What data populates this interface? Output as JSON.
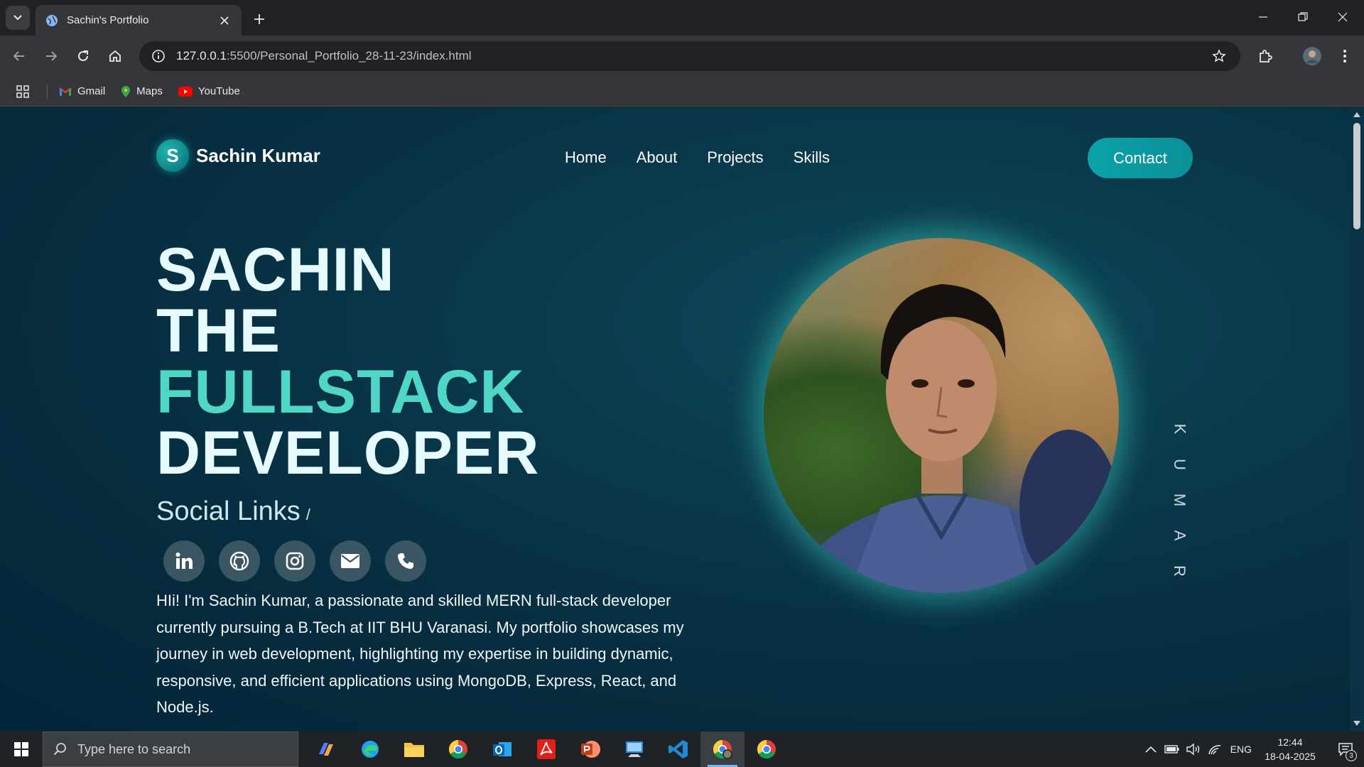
{
  "browser": {
    "tab_title": "Sachin's Portfolio",
    "url_host": "127.0.0.1",
    "url_rest": ":5500/Personal_Portfolio_28-11-23/index.html",
    "bookmarks": [
      {
        "label": "Gmail",
        "icon": "gmail-icon"
      },
      {
        "label": "Maps",
        "icon": "maps-icon"
      },
      {
        "label": "YouTube",
        "icon": "youtube-icon"
      }
    ]
  },
  "site": {
    "brand_letter": "S",
    "brand_name": "Sachin Kumar",
    "nav": [
      "Home",
      "About",
      "Projects",
      "Skills"
    ],
    "contact_label": "Contact",
    "hero": {
      "line1": "SACHIN",
      "line2": "THE",
      "line3": "FULLSTACK",
      "line4": "DEVELOPER"
    },
    "social_title": "Social Links",
    "social_slash": "/",
    "social_icons": [
      "linkedin-icon",
      "github-icon",
      "instagram-icon",
      "email-icon",
      "phone-icon"
    ],
    "bio": "HIi! I'm Sachin Kumar, a passionate and skilled MERN full-stack developer currently pursuing a B.Tech at IIT BHU Varanasi. My portfolio showcases my journey in web development, highlighting my expertise in building dynamic, responsive, and efficient applications using MongoDB, Express, React, and Node.js.",
    "side_letters": [
      "K",
      "U",
      "M",
      "A",
      "R"
    ],
    "accent_color": "#4fd6c5"
  },
  "taskbar": {
    "search_placeholder": "Type here to search",
    "language": "ENG",
    "time": "12:44",
    "date": "18-04-2025",
    "notification_count": "3"
  }
}
